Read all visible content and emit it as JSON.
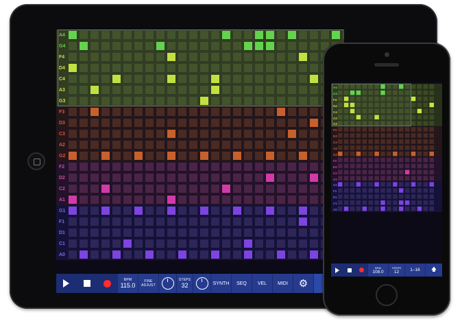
{
  "ipad": {
    "row_labels": [
      "A4",
      "G4",
      "F4",
      "D4",
      "C4",
      "A3",
      "G3",
      "F3",
      "D3",
      "C3",
      "A2",
      "G2",
      "F2",
      "D2",
      "C2",
      "A1",
      "G1",
      "F1",
      "D1",
      "C1",
      "A0"
    ],
    "transport": {
      "play_icon": "play-icon",
      "stop_icon": "stop-icon",
      "record_icon": "record-icon"
    },
    "bpm": {
      "label": "BPM",
      "value": "115.0"
    },
    "fine": {
      "line1": "FINE",
      "line2": "ADJUST"
    },
    "steps": {
      "label": "STEPS",
      "value": "32"
    },
    "tabs": [
      "SYNTH",
      "SEQ",
      "VEL",
      "MIDI"
    ],
    "settings_icon": "gear-icon"
  },
  "iphone": {
    "row_labels": [
      "A4",
      "G4",
      "F4",
      "D4",
      "C4",
      "A3",
      "G3",
      "F3",
      "D3",
      "C3",
      "A2",
      "G2",
      "F2",
      "D2",
      "C2",
      "A1",
      "G1",
      "F1",
      "D1",
      "C1",
      "A0"
    ],
    "bpm": {
      "label": "BPM",
      "value": "108.0"
    },
    "steps": {
      "label": "STEPS",
      "value": "12"
    },
    "page": "1–16",
    "up_icon": "arrow-up-icon"
  },
  "colors": {
    "green": "#7fd43a",
    "yellow": "#d8e83c",
    "orange": "#d2652c",
    "magenta": "#c8379e",
    "violet": "#7b3fd8",
    "toolbar": "#263b8e"
  }
}
